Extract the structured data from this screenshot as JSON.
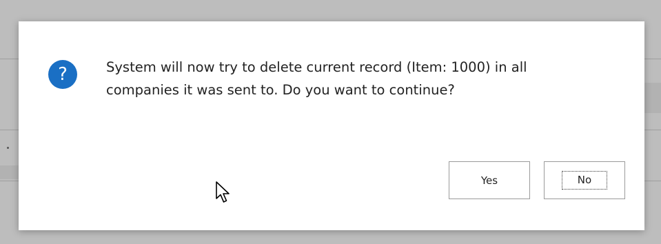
{
  "dialog": {
    "icon": "question-icon",
    "icon_glyph": "?",
    "message_line1": "System will now try to delete current record (Item: 1000) in all",
    "message_line2": "companies it was sent to. Do you want to continue?",
    "yes_label": "Yes",
    "no_label": "No",
    "focused_button": "No"
  },
  "colors": {
    "icon_background": "#1a6fc4",
    "dialog_background": "#ffffff",
    "backdrop": "#bdbdbd"
  },
  "cursor": {
    "icon": "mouse-pointer-icon"
  }
}
